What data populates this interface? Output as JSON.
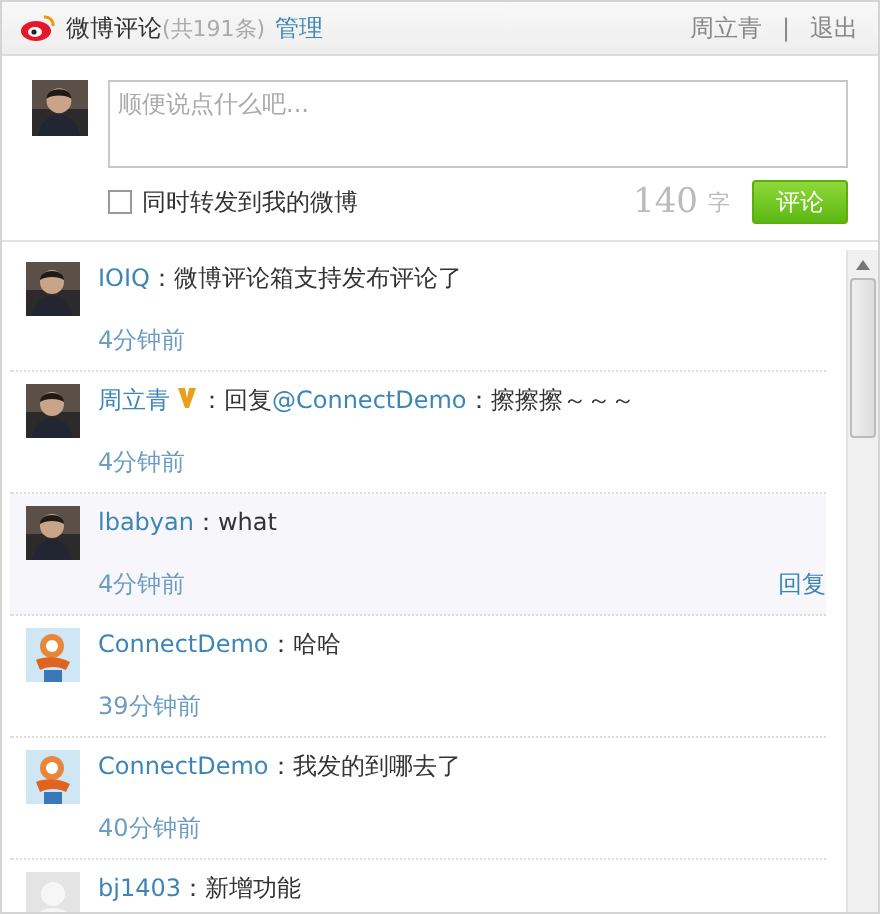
{
  "header": {
    "title": "微博评论",
    "count": "(共191条)",
    "manage_link": "管理",
    "user": "周立青",
    "separator": "|",
    "logout": "退出"
  },
  "composer": {
    "placeholder": "顺便说点什么吧...",
    "repost_label": "同时转发到我的微博",
    "repost_checked": false,
    "char_count": "140",
    "char_unit": "字",
    "submit": "评论"
  },
  "comments": [
    {
      "user": "IOIQ",
      "verified": false,
      "highlighted": false,
      "message": [
        {
          "kind": "text",
          "text": "：微博评论箱支持发布评论了"
        }
      ],
      "time": "4分钟前"
    },
    {
      "user": "周立青",
      "verified": true,
      "highlighted": false,
      "message": [
        {
          "kind": "text",
          "text": "：回复"
        },
        {
          "kind": "mention",
          "text": "@ConnectDemo"
        },
        {
          "kind": "text",
          "text": "：擦擦擦～～～"
        }
      ],
      "time": "4分钟前"
    },
    {
      "user": "lbabyan",
      "verified": false,
      "highlighted": true,
      "message": [
        {
          "kind": "text",
          "text": "：what"
        }
      ],
      "time": "4分钟前",
      "reply": "回复"
    },
    {
      "user": "ConnectDemo",
      "avatar": {
        "kind": "mascot"
      },
      "verified": false,
      "highlighted": false,
      "message": [
        {
          "kind": "text",
          "text": "：哈哈"
        }
      ],
      "time": "39分钟前"
    },
    {
      "user": "ConnectDemo",
      "avatar": {
        "kind": "mascot"
      },
      "verified": false,
      "highlighted": false,
      "message": [
        {
          "kind": "text",
          "text": "：我发的到哪去了"
        }
      ],
      "time": "40分钟前"
    },
    {
      "user": "bj1403",
      "avatar": {
        "kind": "placeholder"
      },
      "verified": false,
      "highlighted": false,
      "message": [
        {
          "kind": "text",
          "text": "：新增功能"
        }
      ]
    }
  ]
}
